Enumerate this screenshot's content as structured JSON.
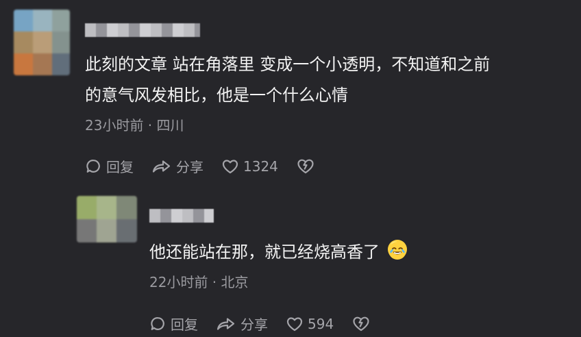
{
  "comment": {
    "text_line_1": "此刻的文章 站在角落里 变成一个小透明，不知道和之前",
    "text_line_2": "的意气风发相比，他是一个什么心情",
    "meta": "23小时前 · 四川",
    "actions": {
      "reply": "回复",
      "share": "分享",
      "likes": "1324"
    }
  },
  "reply": {
    "text": "他还能站在那，就已经烧高香了",
    "meta": "22小时前 · 北京",
    "actions": {
      "reply": "回复",
      "share": "分享",
      "likes": "594"
    }
  },
  "icons": {
    "reply_icon": "speech-bubble-icon",
    "share_icon": "share-arrow-icon",
    "like_icon": "heart-icon",
    "dislike_icon": "broken-heart-icon",
    "emoji_icon": "crying-laughing-emoji-icon"
  },
  "colors": {
    "background": "#26262a",
    "text": "#f3f3f3",
    "muted_text": "#9b9ba0",
    "icon": "#a5a5aa"
  }
}
